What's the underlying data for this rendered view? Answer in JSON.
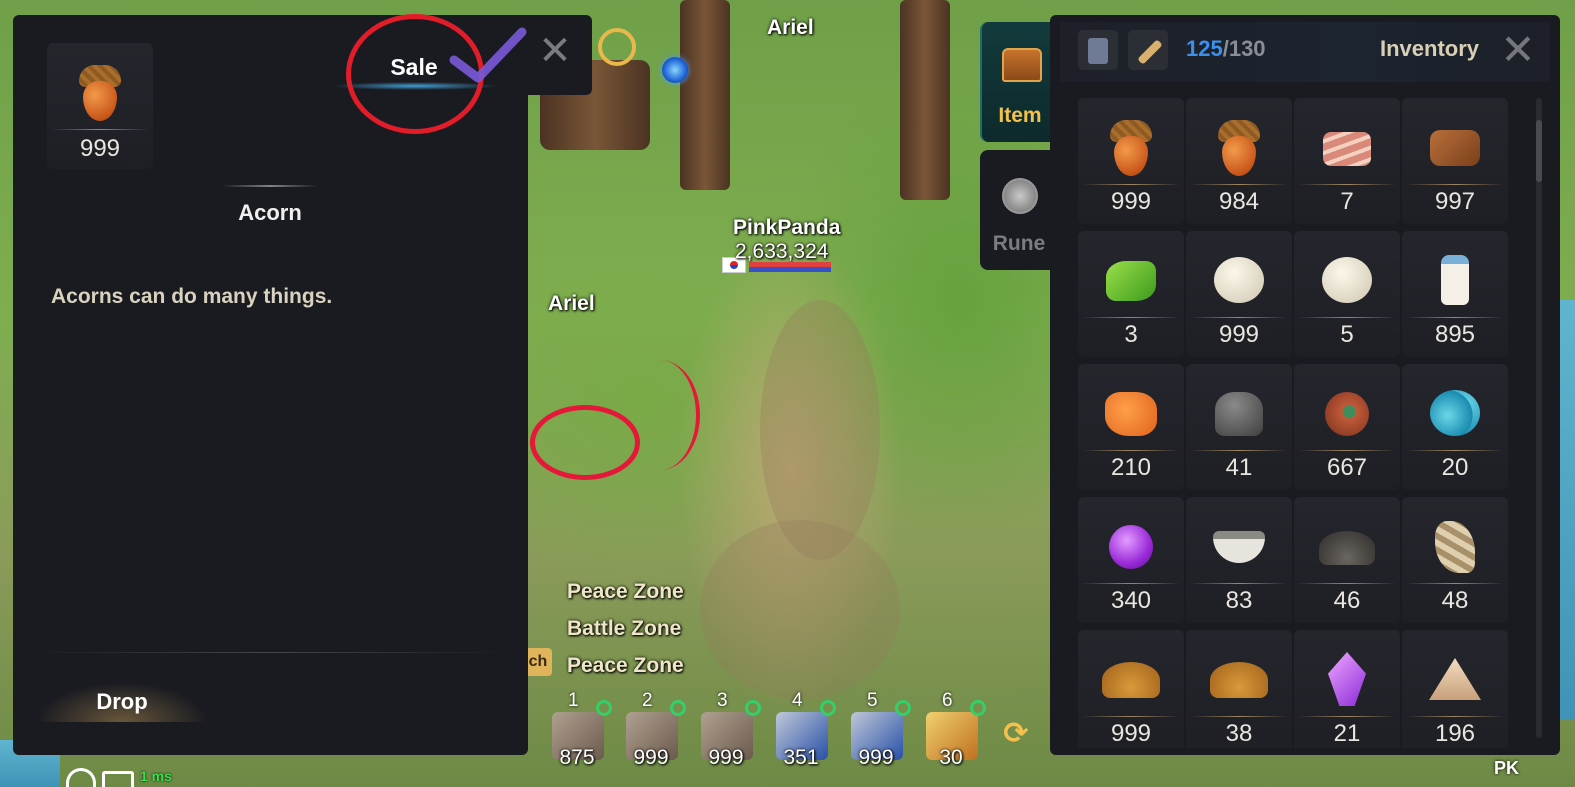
{
  "detail": {
    "item_count": "999",
    "item_name": "Acorn",
    "item_description": "Acorns can do many things.",
    "sale_label": "Sale",
    "close_symbol": "✕",
    "drop_label": "Drop"
  },
  "inventory": {
    "title": "Inventory",
    "capacity_used": "125",
    "capacity_total": "/130",
    "close_symbol": "✕",
    "tabs": [
      {
        "label": "Item",
        "icon": "treasure-chest-icon"
      },
      {
        "label": "Rune",
        "icon": "rune-icon"
      }
    ],
    "items": [
      {
        "name": "acorn",
        "count": "999"
      },
      {
        "name": "acorn",
        "count": "984"
      },
      {
        "name": "bacon",
        "count": "7"
      },
      {
        "name": "meat",
        "count": "997"
      },
      {
        "name": "green-leaf",
        "count": "3"
      },
      {
        "name": "cotton-ball",
        "count": "999"
      },
      {
        "name": "cotton-ball",
        "count": "5"
      },
      {
        "name": "milk-bottle",
        "count": "895"
      },
      {
        "name": "orange-ore",
        "count": "210"
      },
      {
        "name": "stone",
        "count": "41"
      },
      {
        "name": "snail-shell",
        "count": "667"
      },
      {
        "name": "blue-bubbles",
        "count": "20"
      },
      {
        "name": "purple-orb",
        "count": "340"
      },
      {
        "name": "bowl",
        "count": "83"
      },
      {
        "name": "dirt-pile",
        "count": "46"
      },
      {
        "name": "claws",
        "count": "48"
      },
      {
        "name": "grain-pile",
        "count": "999"
      },
      {
        "name": "grain-pile",
        "count": "38"
      },
      {
        "name": "purple-crystal",
        "count": "21"
      },
      {
        "name": "sand-pile",
        "count": "196"
      }
    ]
  },
  "world": {
    "zone_title": "Ariel",
    "player_name": "PinkPanda",
    "player_power": "2,633,324",
    "npc_name": "Ariel",
    "zone_lines": [
      "Peace Zone",
      "Battle Zone",
      "Peace Zone"
    ],
    "switch_tab_text": "ch",
    "skills": [
      {
        "slot": "1",
        "count": "875"
      },
      {
        "slot": "2",
        "count": "999"
      },
      {
        "slot": "3",
        "count": "999"
      },
      {
        "slot": "4",
        "count": "351"
      },
      {
        "slot": "5",
        "count": "999"
      },
      {
        "slot": "6",
        "count": "30"
      }
    ],
    "latency": "1 ms",
    "pk_label": "PK"
  },
  "colors": {
    "capacity_used": "#3c8fea",
    "annotation_circle": "#e11d2a",
    "annotation_check": "#7a5ad8",
    "item_tab_label": "#f2c14e"
  }
}
